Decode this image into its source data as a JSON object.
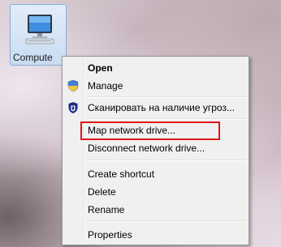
{
  "desktop": {
    "icon_label": "Compute"
  },
  "menu": {
    "items": [
      {
        "label": "Open"
      },
      {
        "label": "Manage"
      },
      {
        "label": "Сканировать на наличие угроз..."
      },
      {
        "label": "Map network drive..."
      },
      {
        "label": "Disconnect network drive..."
      },
      {
        "label": "Create shortcut"
      },
      {
        "label": "Delete"
      },
      {
        "label": "Rename"
      },
      {
        "label": "Properties"
      }
    ]
  },
  "icons": {
    "desktop_icon": "computer-icon",
    "manage": "uac-shield-icon",
    "scan": "antivirus-shield-icon"
  },
  "colors": {
    "highlight_border": "#e0161b",
    "menu_background": "#f0f0f0",
    "selection_tile": "#cadcf1"
  }
}
